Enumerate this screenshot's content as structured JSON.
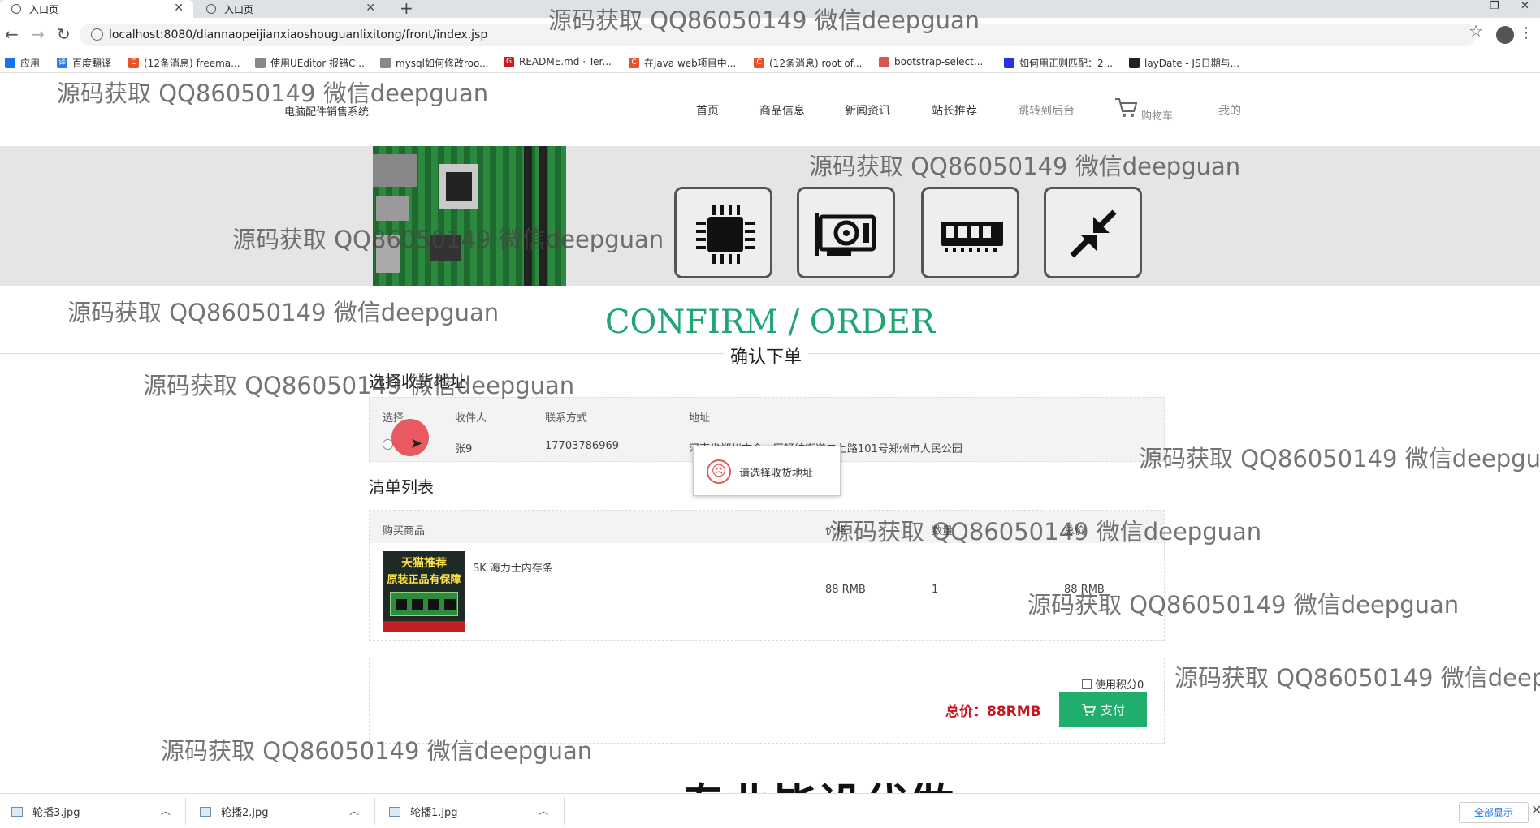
{
  "browser": {
    "tabs": [
      {
        "label": "入口页",
        "active": true
      },
      {
        "label": "入口页",
        "active": false
      }
    ],
    "url": "localhost:8080/diannaopeijianxiaoshouguanlixitong/front/index.jsp",
    "bookmarks": [
      "应用",
      "百度翻译",
      "(12条消息) freema...",
      "使用UEditor 报错C...",
      "mysql如何修改roo...",
      "README.md · Ter...",
      "在java web项目中...",
      "(12条消息) root of...",
      "bootstrap-select...",
      "如何用正则匹配：2...",
      "layDate - JS日期与..."
    ]
  },
  "site": {
    "title": "电脑配件销售系统",
    "nav": [
      "首页",
      "商品信息",
      "新闻资讯",
      "站长推荐",
      "跳转到后台",
      "购物车",
      "我的"
    ]
  },
  "page": {
    "heading_en": "CONFIRM / ORDER",
    "heading_cn": "确认下单"
  },
  "address": {
    "title": "选择收货地址",
    "columns": [
      "选择",
      "收件人",
      "联系方式",
      "地址"
    ],
    "rows": [
      {
        "name": "张9",
        "phone": "17703786969",
        "address": "河南省郑州市金水区轻纺街道二七路101号郑州市人民公园"
      }
    ]
  },
  "toast": {
    "message": "请选择收货地址"
  },
  "items": {
    "title": "清单列表",
    "columns": [
      "购买商品",
      "价格",
      "数量",
      "总价"
    ],
    "rows": [
      {
        "name": "SK 海力士内存条",
        "price": "88 RMB",
        "qty": "1",
        "total": "88 RMB",
        "image_text_1": "天猫推荐",
        "image_text_2": "原装正品有保障"
      }
    ]
  },
  "summary": {
    "points_label": "使用积分0",
    "total_label": "总价：88RMB",
    "pay_label": "支付"
  },
  "watermark": {
    "text": "源码获取 QQ86050149 微信deepguan",
    "big_text": "专业毕设代做"
  },
  "downloads": {
    "files": [
      "轮播3.jpg",
      "轮播2.jpg",
      "轮播1.jpg"
    ],
    "show_all": "全部显示"
  },
  "colors": {
    "accent_green": "#1fa672",
    "pay_green": "#1fae6b",
    "price_red": "#c9151e"
  }
}
